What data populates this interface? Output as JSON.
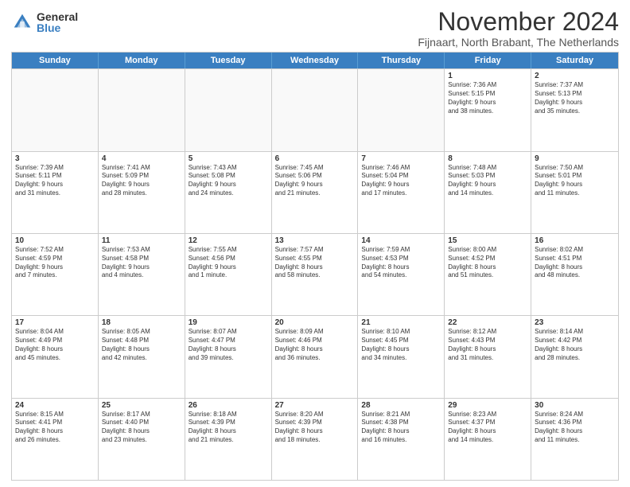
{
  "logo": {
    "general": "General",
    "blue": "Blue"
  },
  "title": "November 2024",
  "subtitle": "Fijnaart, North Brabant, The Netherlands",
  "header_days": [
    "Sunday",
    "Monday",
    "Tuesday",
    "Wednesday",
    "Thursday",
    "Friday",
    "Saturday"
  ],
  "rows": [
    [
      {
        "day": "",
        "text": "",
        "empty": true
      },
      {
        "day": "",
        "text": "",
        "empty": true
      },
      {
        "day": "",
        "text": "",
        "empty": true
      },
      {
        "day": "",
        "text": "",
        "empty": true
      },
      {
        "day": "",
        "text": "",
        "empty": true
      },
      {
        "day": "1",
        "text": "Sunrise: 7:36 AM\nSunset: 5:15 PM\nDaylight: 9 hours\nand 38 minutes.",
        "empty": false
      },
      {
        "day": "2",
        "text": "Sunrise: 7:37 AM\nSunset: 5:13 PM\nDaylight: 9 hours\nand 35 minutes.",
        "empty": false
      }
    ],
    [
      {
        "day": "3",
        "text": "Sunrise: 7:39 AM\nSunset: 5:11 PM\nDaylight: 9 hours\nand 31 minutes.",
        "empty": false
      },
      {
        "day": "4",
        "text": "Sunrise: 7:41 AM\nSunset: 5:09 PM\nDaylight: 9 hours\nand 28 minutes.",
        "empty": false
      },
      {
        "day": "5",
        "text": "Sunrise: 7:43 AM\nSunset: 5:08 PM\nDaylight: 9 hours\nand 24 minutes.",
        "empty": false
      },
      {
        "day": "6",
        "text": "Sunrise: 7:45 AM\nSunset: 5:06 PM\nDaylight: 9 hours\nand 21 minutes.",
        "empty": false
      },
      {
        "day": "7",
        "text": "Sunrise: 7:46 AM\nSunset: 5:04 PM\nDaylight: 9 hours\nand 17 minutes.",
        "empty": false
      },
      {
        "day": "8",
        "text": "Sunrise: 7:48 AM\nSunset: 5:03 PM\nDaylight: 9 hours\nand 14 minutes.",
        "empty": false
      },
      {
        "day": "9",
        "text": "Sunrise: 7:50 AM\nSunset: 5:01 PM\nDaylight: 9 hours\nand 11 minutes.",
        "empty": false
      }
    ],
    [
      {
        "day": "10",
        "text": "Sunrise: 7:52 AM\nSunset: 4:59 PM\nDaylight: 9 hours\nand 7 minutes.",
        "empty": false
      },
      {
        "day": "11",
        "text": "Sunrise: 7:53 AM\nSunset: 4:58 PM\nDaylight: 9 hours\nand 4 minutes.",
        "empty": false
      },
      {
        "day": "12",
        "text": "Sunrise: 7:55 AM\nSunset: 4:56 PM\nDaylight: 9 hours\nand 1 minute.",
        "empty": false
      },
      {
        "day": "13",
        "text": "Sunrise: 7:57 AM\nSunset: 4:55 PM\nDaylight: 8 hours\nand 58 minutes.",
        "empty": false
      },
      {
        "day": "14",
        "text": "Sunrise: 7:59 AM\nSunset: 4:53 PM\nDaylight: 8 hours\nand 54 minutes.",
        "empty": false
      },
      {
        "day": "15",
        "text": "Sunrise: 8:00 AM\nSunset: 4:52 PM\nDaylight: 8 hours\nand 51 minutes.",
        "empty": false
      },
      {
        "day": "16",
        "text": "Sunrise: 8:02 AM\nSunset: 4:51 PM\nDaylight: 8 hours\nand 48 minutes.",
        "empty": false
      }
    ],
    [
      {
        "day": "17",
        "text": "Sunrise: 8:04 AM\nSunset: 4:49 PM\nDaylight: 8 hours\nand 45 minutes.",
        "empty": false
      },
      {
        "day": "18",
        "text": "Sunrise: 8:05 AM\nSunset: 4:48 PM\nDaylight: 8 hours\nand 42 minutes.",
        "empty": false
      },
      {
        "day": "19",
        "text": "Sunrise: 8:07 AM\nSunset: 4:47 PM\nDaylight: 8 hours\nand 39 minutes.",
        "empty": false
      },
      {
        "day": "20",
        "text": "Sunrise: 8:09 AM\nSunset: 4:46 PM\nDaylight: 8 hours\nand 36 minutes.",
        "empty": false
      },
      {
        "day": "21",
        "text": "Sunrise: 8:10 AM\nSunset: 4:45 PM\nDaylight: 8 hours\nand 34 minutes.",
        "empty": false
      },
      {
        "day": "22",
        "text": "Sunrise: 8:12 AM\nSunset: 4:43 PM\nDaylight: 8 hours\nand 31 minutes.",
        "empty": false
      },
      {
        "day": "23",
        "text": "Sunrise: 8:14 AM\nSunset: 4:42 PM\nDaylight: 8 hours\nand 28 minutes.",
        "empty": false
      }
    ],
    [
      {
        "day": "24",
        "text": "Sunrise: 8:15 AM\nSunset: 4:41 PM\nDaylight: 8 hours\nand 26 minutes.",
        "empty": false
      },
      {
        "day": "25",
        "text": "Sunrise: 8:17 AM\nSunset: 4:40 PM\nDaylight: 8 hours\nand 23 minutes.",
        "empty": false
      },
      {
        "day": "26",
        "text": "Sunrise: 8:18 AM\nSunset: 4:39 PM\nDaylight: 8 hours\nand 21 minutes.",
        "empty": false
      },
      {
        "day": "27",
        "text": "Sunrise: 8:20 AM\nSunset: 4:39 PM\nDaylight: 8 hours\nand 18 minutes.",
        "empty": false
      },
      {
        "day": "28",
        "text": "Sunrise: 8:21 AM\nSunset: 4:38 PM\nDaylight: 8 hours\nand 16 minutes.",
        "empty": false
      },
      {
        "day": "29",
        "text": "Sunrise: 8:23 AM\nSunset: 4:37 PM\nDaylight: 8 hours\nand 14 minutes.",
        "empty": false
      },
      {
        "day": "30",
        "text": "Sunrise: 8:24 AM\nSunset: 4:36 PM\nDaylight: 8 hours\nand 11 minutes.",
        "empty": false
      }
    ]
  ]
}
